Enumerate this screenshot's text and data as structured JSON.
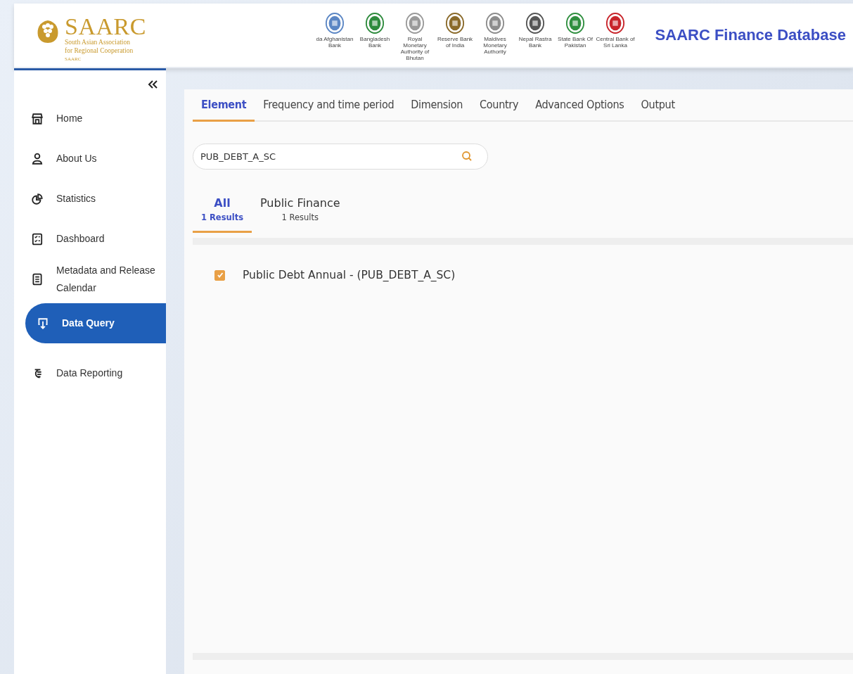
{
  "header": {
    "logo": {
      "emblem_text": "SAARC",
      "name": "SAARC",
      "tagline_1": "South Asian Association",
      "tagline_2": "for Regional Cooperation"
    },
    "banks": [
      {
        "label": "da Afghanistan Bank",
        "color": "#5b86c4"
      },
      {
        "label": "Bangladesh Bank",
        "color": "#2e8b3d"
      },
      {
        "label": "Royal Monetary Authority of Bhutan",
        "color": "#9a9a9a"
      },
      {
        "label": "Reserve Bank of India",
        "color": "#8a6a2a"
      },
      {
        "label": "Maldives Monetary Authority",
        "color": "#8c8c8c"
      },
      {
        "label": "Nepal Rastra Bank",
        "color": "#555555"
      },
      {
        "label": "State Bank Of Pakistan",
        "color": "#2f8f3f"
      },
      {
        "label": "Central Bank of Sri Lanka",
        "color": "#c8242a"
      }
    ],
    "title": "SAARC Finance Database"
  },
  "sidebar": {
    "items": [
      {
        "label": "Home",
        "selected": false
      },
      {
        "label": "About Us",
        "selected": false
      },
      {
        "label": "Statistics",
        "selected": false
      },
      {
        "label": "Dashboard",
        "selected": false
      },
      {
        "label": "Metadata and Release Calendar",
        "selected": false
      },
      {
        "label": "Data Query",
        "selected": true
      },
      {
        "label": "Data Reporting",
        "selected": false
      }
    ]
  },
  "tabs": [
    {
      "label": "Element",
      "selected": true
    },
    {
      "label": "Frequency and time period",
      "selected": false
    },
    {
      "label": "Dimension",
      "selected": false
    },
    {
      "label": "Country",
      "selected": false
    },
    {
      "label": "Advanced Options",
      "selected": false
    },
    {
      "label": "Output",
      "selected": false
    }
  ],
  "search": {
    "value": "PUB_DEBT_A_SC"
  },
  "result_tabs": [
    {
      "label": "All",
      "count": "1 Results",
      "selected": true
    },
    {
      "label": "Public Finance",
      "count": "1 Results",
      "selected": false
    }
  ],
  "results": [
    {
      "label": "Public Debt Annual - (PUB_DEBT_A_SC)",
      "checked": true
    }
  ]
}
